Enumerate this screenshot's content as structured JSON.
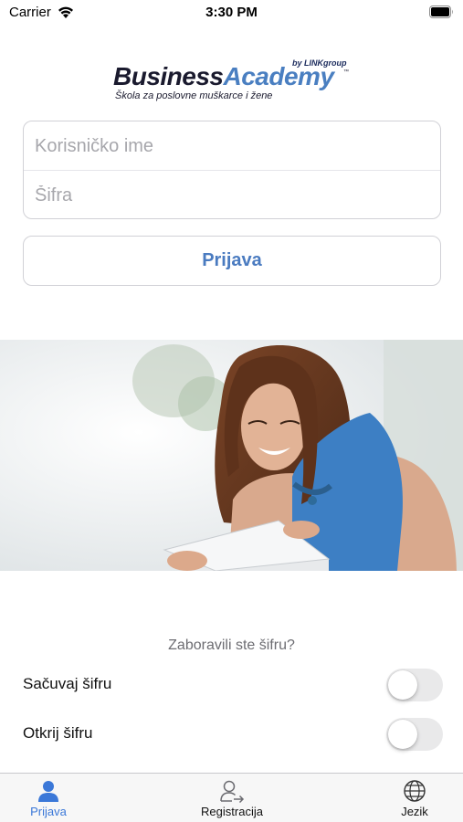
{
  "status_bar": {
    "carrier": "Carrier",
    "time": "3:30 PM",
    "icons": [
      "wifi-icon",
      "battery-icon"
    ]
  },
  "logo": {
    "byline": "by LINKgroup",
    "brand_first": "Business",
    "brand_second": "Academy",
    "trademark": "™",
    "tagline": "Škola za poslovne muškarce i žene",
    "colors": {
      "dark": "#1a1a2e",
      "accent": "#4a7fc1"
    }
  },
  "login_form": {
    "username_placeholder": "Korisničko ime",
    "username_value": "",
    "password_placeholder": "Šifra",
    "password_value": "",
    "submit_label": "Prijava"
  },
  "hero_image": {
    "description_icon": "hero-photo"
  },
  "forgot_password_label": "Zaboravili ste šifru?",
  "settings": {
    "save_password": {
      "label": "Sačuvaj šifru",
      "enabled": false
    },
    "reveal_password": {
      "label": "Otkrij šifru",
      "enabled": false
    }
  },
  "tab_bar": {
    "tabs": [
      {
        "label": "Prijava",
        "icon": "person-icon",
        "active": true
      },
      {
        "label": "Registracija",
        "icon": "register-person-icon",
        "active": false
      },
      {
        "label": "Jezik",
        "icon": "globe-icon",
        "active": false
      }
    ],
    "active_color": "#3b78d8"
  },
  "colors": {
    "accent": "#4a7bc0",
    "placeholder": "#a7a7ac",
    "secondary_text": "#6d6d72",
    "switch_off": "#e9e9ea"
  }
}
